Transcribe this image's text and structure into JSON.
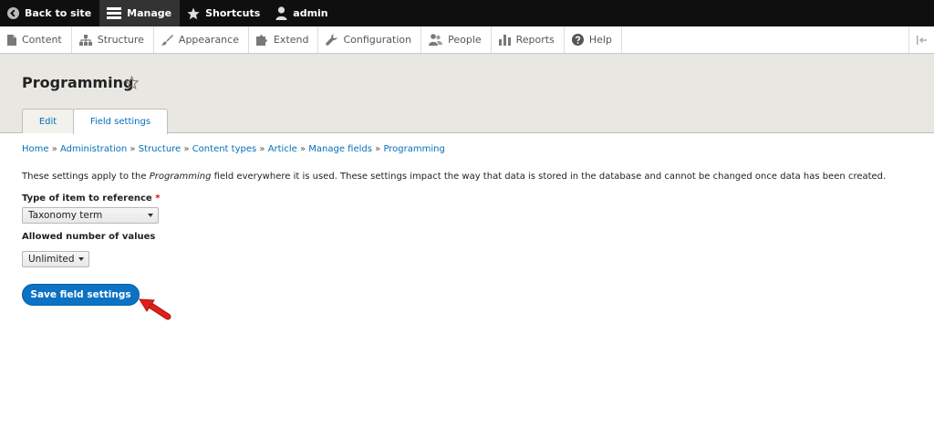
{
  "toolbar": {
    "back_label": "Back to site",
    "manage_label": "Manage",
    "shortcuts_label": "Shortcuts",
    "user_label": "admin"
  },
  "tray": {
    "items": [
      {
        "label": "Content",
        "icon": "page-icon"
      },
      {
        "label": "Structure",
        "icon": "sitemap-icon"
      },
      {
        "label": "Appearance",
        "icon": "brush-icon"
      },
      {
        "label": "Extend",
        "icon": "puzzle-icon"
      },
      {
        "label": "Configuration",
        "icon": "wrench-icon"
      },
      {
        "label": "People",
        "icon": "people-icon"
      },
      {
        "label": "Reports",
        "icon": "bar-chart-icon"
      },
      {
        "label": "Help",
        "icon": "question-icon"
      }
    ]
  },
  "page": {
    "title": "Programming",
    "tabs": [
      {
        "label": "Edit"
      },
      {
        "label": "Field settings"
      }
    ]
  },
  "breadcrumb": {
    "items": [
      "Home",
      "Administration",
      "Structure",
      "Content types",
      "Article",
      "Manage fields",
      "Programming"
    ],
    "separator": "»"
  },
  "intro": {
    "before": "These settings apply to the ",
    "field": "Programming",
    "after": " field everywhere it is used. These settings impact the way that data is stored in the database and cannot be changed once data has been created."
  },
  "form": {
    "type_label": "Type of item to reference",
    "required_mark": "*",
    "type_value": "Taxonomy term",
    "cardinality_label": "Allowed number of values",
    "cardinality_value": "Unlimited",
    "save_label": "Save field settings"
  },
  "colors": {
    "toolbar_bg": "#0f0f0f",
    "link": "#0071b8",
    "button": "#0b72c4",
    "header_bg": "#e8e7e2",
    "annotation_arrow": "#e0201a"
  }
}
